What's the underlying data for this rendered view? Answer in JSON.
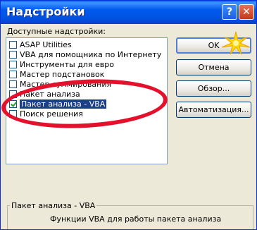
{
  "window": {
    "title": "Надстройки",
    "help_label": "?",
    "close_label": "✕"
  },
  "addins_label": "Доступные надстройки:",
  "addins": [
    {
      "label": "ASAP Utilities",
      "checked": false
    },
    {
      "label": "VBA для помощника по Интернету",
      "checked": false
    },
    {
      "label": "Инструменты для евро",
      "checked": false
    },
    {
      "label": "Мастер подстановок",
      "checked": false
    },
    {
      "label": "Мастер суммирования",
      "checked": false
    },
    {
      "label": "Пакет анализа",
      "checked": false
    },
    {
      "label": "Пакет анализа - VBA",
      "checked": true,
      "selected": true
    },
    {
      "label": "Поиск решения",
      "checked": false
    }
  ],
  "buttons": {
    "ok": "OK",
    "cancel": "Отмена",
    "browse": "Обзор...",
    "automation": "Автоматизация..."
  },
  "details": {
    "title": "Пакет анализа - VBA",
    "description": "Функции VBA для работы пакета анализа"
  },
  "colors": {
    "title_bar": "#0055e5",
    "selection": "#1c3f8a",
    "highlight_oval": "#e3112c",
    "dialog_bg": "#ece9d8"
  }
}
